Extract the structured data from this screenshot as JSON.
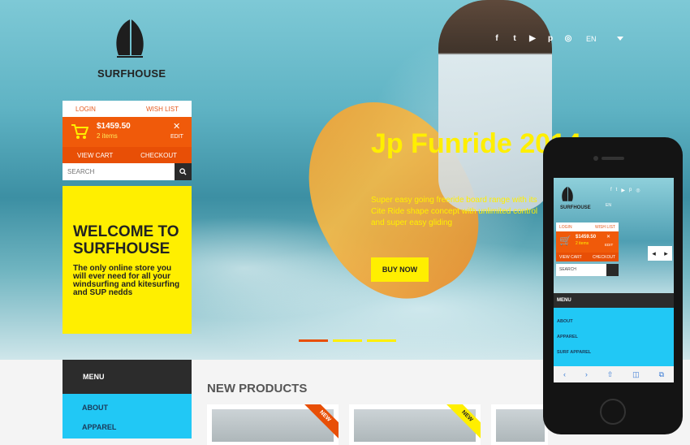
{
  "brand": {
    "name": "SURFHOUSE"
  },
  "header": {
    "social_icons": [
      "facebook-icon",
      "twitter-icon",
      "youtube-icon",
      "pinterest-icon",
      "instagram-icon"
    ],
    "social_glyphs": [
      "f",
      "t",
      "▶",
      "p",
      "◎"
    ],
    "language": "EN"
  },
  "account": {
    "login": "LOGIN",
    "wishlist": "WISH LIST"
  },
  "cart": {
    "total": "$1459.50",
    "items": "2 items",
    "close": "✕",
    "edit": "EDIT",
    "view_cart": "VIEW CART",
    "checkout": "CHECKOUT"
  },
  "search": {
    "placeholder": "SEARCH"
  },
  "welcome": {
    "title": "WELCOME TO SURFHOUSE",
    "text": "The only online store you will ever need for all your windsurfing and kitesurfing and SUP nedds"
  },
  "slide": {
    "title": "Jp Funride 2014",
    "description": "Super easy going freeride board range with its Cite Ride shape concept with unlimited control and super easy gliding",
    "cta": "BUY NOW",
    "active_index": 0,
    "indicator_colors": [
      "#e84f06",
      "#ffef00",
      "#ffef00"
    ]
  },
  "menu": {
    "title": "MENU",
    "items": [
      "ABOUT",
      "APPAREL"
    ]
  },
  "products": {
    "title": "NEW PRODUCTS",
    "cards": [
      {
        "badge": "NEW",
        "badge_color": "#e84f06"
      },
      {
        "badge": "NEW",
        "badge_color": "#ffef00"
      }
    ]
  },
  "phone": {
    "social_glyphs": [
      "f",
      "t",
      "▶",
      "p",
      "◎"
    ],
    "menu_items": [
      "ABOUT",
      "APPAREL",
      "SURF APPAREL"
    ],
    "toolbar": [
      "‹",
      "›",
      "⇧",
      "◫",
      "⧉"
    ]
  },
  "colors": {
    "accent_orange": "#f05a0a",
    "accent_yellow": "#ffef00",
    "menu_blue": "#21c8f5",
    "dark": "#2c2c2c"
  }
}
